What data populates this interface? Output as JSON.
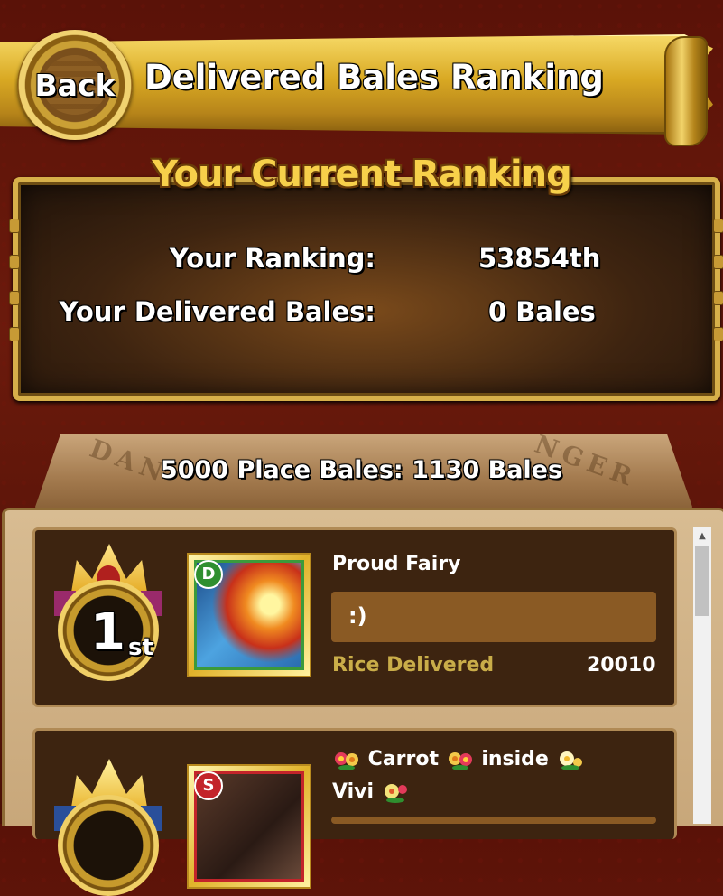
{
  "header": {
    "back_label": "Back",
    "title": "Delivered Bales Ranking"
  },
  "current_ranking": {
    "heading": "Your Current Ranking",
    "ranking_label": "Your Ranking:",
    "ranking_value": "53854th",
    "bales_label": "Your Delivered Bales:",
    "bales_value": "0 Bales"
  },
  "threshold": {
    "text": "5000 Place Bales: 1130 Bales",
    "sign_left": "DAN",
    "sign_right": "NGER"
  },
  "entries": [
    {
      "rank_number": "1",
      "rank_suffix": "st",
      "card_badge": "D",
      "name": "Proud Fairy",
      "comment": ":)",
      "rice_label": "Rice Delivered",
      "rice_value": "20010"
    },
    {
      "card_badge": "S",
      "name_part1": "Carrot",
      "name_part2": "inside",
      "name_part3": "Vivi"
    }
  ],
  "colors": {
    "gold": "#d9a923",
    "panel_brown": "#3d2410",
    "comment_brown": "#8a5a24",
    "rice_label": "#c9ad49",
    "badge_d": "#2f8f2f",
    "badge_s": "#c3242a"
  }
}
